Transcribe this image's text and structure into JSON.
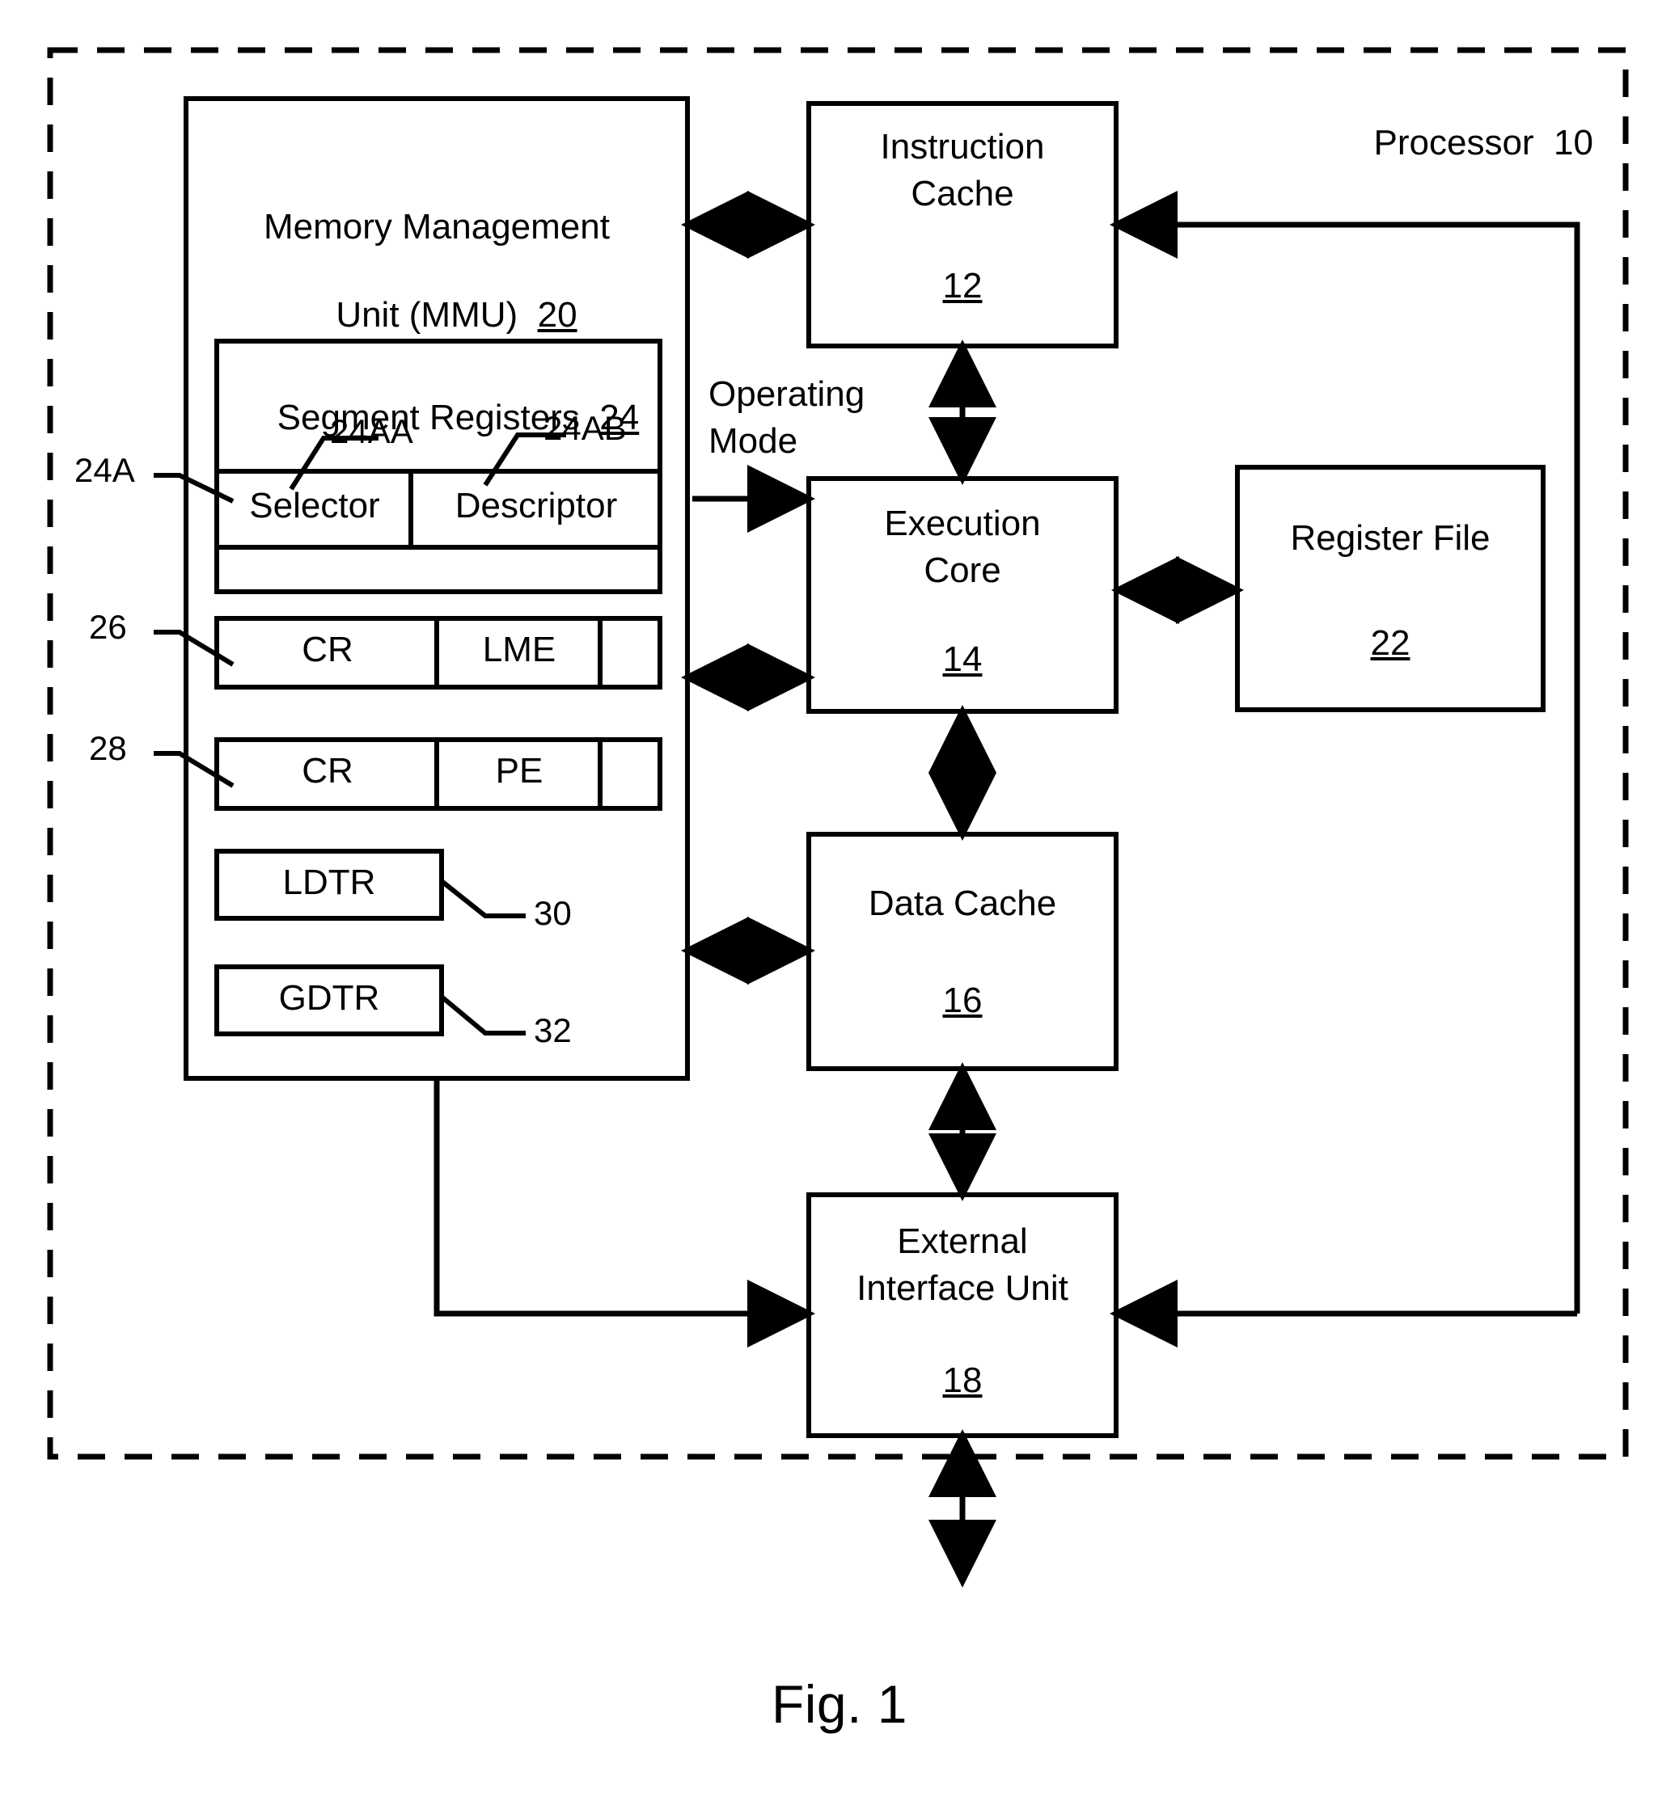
{
  "figure": {
    "caption": "Fig. 1",
    "outer_label": "Processor  10",
    "outer_label_name": "Processor",
    "outer_label_ref": "10",
    "border_style": "dashed"
  },
  "colors": {
    "line": "#000000",
    "background": "#ffffff",
    "text": "#000000"
  },
  "blocks": {
    "mmu": {
      "title_line1": "Memory Management",
      "title_line2": "Unit (MMU)",
      "ref": "20"
    },
    "segment_registers": {
      "title": "Segment Registers",
      "ref": "24",
      "row_ref": "24A",
      "fields": [
        {
          "label": "Selector",
          "ref": "24AA"
        },
        {
          "label": "Descriptor",
          "ref": "24AB"
        }
      ]
    },
    "cr_lme": {
      "ref": "26",
      "cells": [
        "CR",
        "LME",
        ""
      ]
    },
    "cr_pe": {
      "ref": "28",
      "cells": [
        "CR",
        "PE",
        ""
      ]
    },
    "ldtr": {
      "label": "LDTR",
      "ref": "30"
    },
    "gdtr": {
      "label": "GDTR",
      "ref": "32"
    },
    "instruction_cache": {
      "title_line1": "Instruction",
      "title_line2": "Cache",
      "ref": "12"
    },
    "execution_core": {
      "title_line1": "Execution",
      "title_line2": "Core",
      "ref": "14"
    },
    "register_file": {
      "title_line1": "Register File",
      "title_line2": "",
      "ref": "22"
    },
    "data_cache": {
      "title_line1": "Data Cache",
      "title_line2": "",
      "ref": "16"
    },
    "external_interface_unit": {
      "title_line1": "External",
      "title_line2": "Interface Unit",
      "ref": "18"
    }
  },
  "signals": {
    "operating_mode_line1": "Operating",
    "operating_mode_line2": "Mode"
  }
}
